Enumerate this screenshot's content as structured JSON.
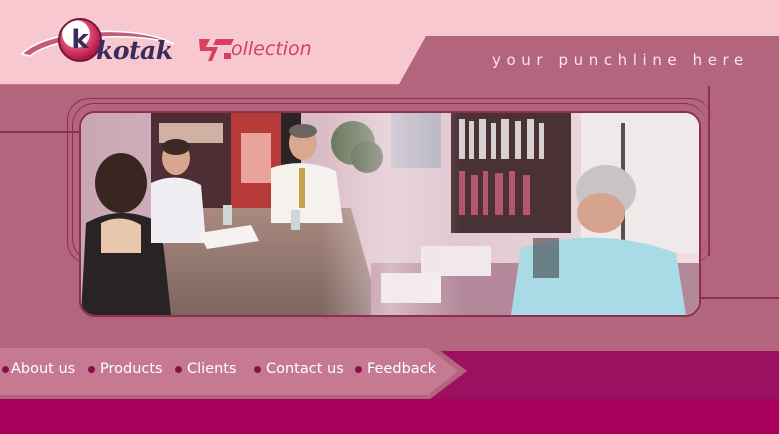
{
  "brand": {
    "logo_text": "kotak",
    "logo_letter": "k",
    "collection_text": "ollection",
    "icons": [
      "kotak-logo-icon",
      "collection-mark-icon"
    ]
  },
  "tagline": "your punchline here",
  "hero": {
    "image_subject": "office-photo"
  },
  "nav": {
    "items": [
      {
        "label": "About us"
      },
      {
        "label": "Products"
      },
      {
        "label": "Clients"
      },
      {
        "label": "Contact us"
      },
      {
        "label": "Feedback"
      }
    ]
  },
  "colors": {
    "header_bg": "#f7c8d0",
    "band": "#b4657e",
    "accent": "#a8005f",
    "line": "#8e2f50",
    "collection_red": "#d6415d"
  }
}
